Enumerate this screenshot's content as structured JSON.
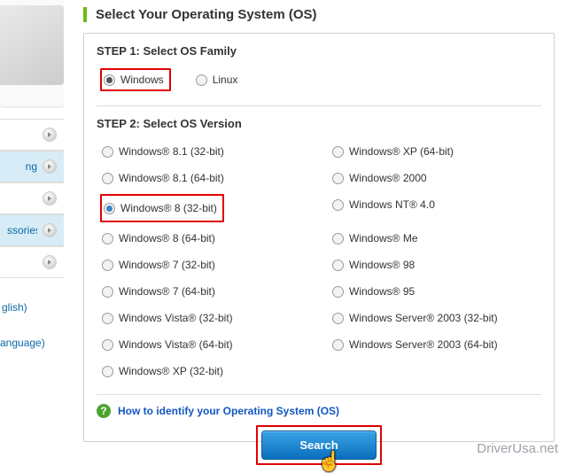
{
  "sidebar": {
    "items": [
      {
        "label": "",
        "has_arrow": true,
        "style": "plain"
      },
      {
        "label": "ng",
        "has_arrow": true,
        "style": "blue"
      },
      {
        "label": "",
        "has_arrow": true,
        "style": "plain"
      },
      {
        "label": "ssories",
        "has_arrow": true,
        "style": "blue"
      },
      {
        "label": "",
        "has_arrow": true,
        "style": "plain"
      }
    ],
    "language_partial_1": "glish)",
    "language_partial_2": "anguage)"
  },
  "section_title": "Select Your Operating System (OS)",
  "step1": {
    "label": "STEP 1: Select OS Family",
    "options": [
      {
        "label": "Windows",
        "checked": true
      },
      {
        "label": "Linux",
        "checked": false
      }
    ]
  },
  "step2": {
    "label": "STEP 2: Select OS Version",
    "left": [
      {
        "label": "Windows® 8.1 (32-bit)",
        "checked": false
      },
      {
        "label": "Windows® 8.1 (64-bit)",
        "checked": false
      },
      {
        "label": "Windows® 8 (32-bit)",
        "checked": true
      },
      {
        "label": "Windows® 8 (64-bit)",
        "checked": false
      },
      {
        "label": "Windows® 7 (32-bit)",
        "checked": false
      },
      {
        "label": "Windows® 7 (64-bit)",
        "checked": false
      },
      {
        "label": "Windows Vista® (32-bit)",
        "checked": false
      },
      {
        "label": "Windows Vista® (64-bit)",
        "checked": false
      },
      {
        "label": "Windows® XP (32-bit)",
        "checked": false
      }
    ],
    "right": [
      {
        "label": "Windows® XP (64-bit)",
        "checked": false
      },
      {
        "label": "Windows® 2000",
        "checked": false
      },
      {
        "label": "Windows NT® 4.0",
        "checked": false
      },
      {
        "label": "Windows® Me",
        "checked": false
      },
      {
        "label": "Windows® 98",
        "checked": false
      },
      {
        "label": "Windows® 95",
        "checked": false
      },
      {
        "label": "Windows Server® 2003 (32-bit)",
        "checked": false
      },
      {
        "label": "Windows Server® 2003 (64-bit)",
        "checked": false
      }
    ]
  },
  "help_link": "How to identify your Operating System (OS)",
  "search_button": "Search",
  "watermark": "DriverUsa.net"
}
